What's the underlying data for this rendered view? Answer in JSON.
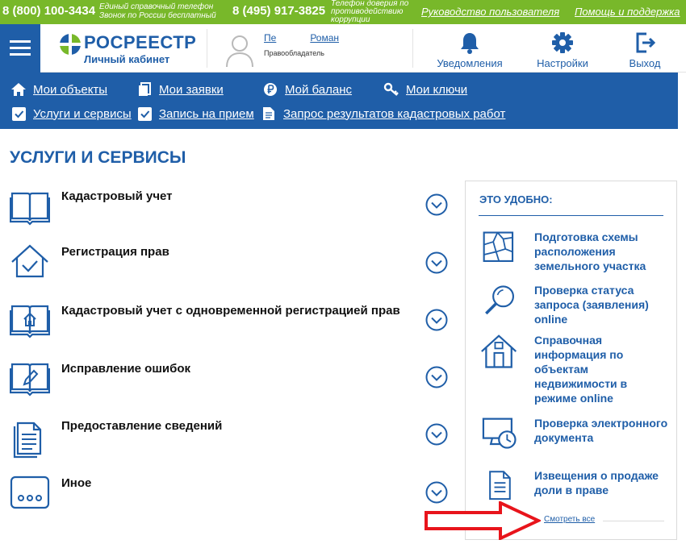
{
  "topbar": {
    "phone1": "8 (800) 100-3434",
    "phone1_note_line1": "Единый справочный телефон",
    "phone1_note_line2": "Звонок по России бесплатный",
    "phone2": "8 (495) 917-3825",
    "phone2_note": "Телефон доверия по противодействию коррупции",
    "link_manual": "Руководство пользователя",
    "link_help": "Помощь и поддержка",
    "color": "#78b82a"
  },
  "header": {
    "logo_title": "РОСРЕЕСТР",
    "logo_subtitle": "Личный кабинет",
    "user_first": "Пе",
    "user_last": "Роман",
    "user_role": "Правообладатель",
    "buttons": {
      "notifications": "Уведомления",
      "settings": "Настройки",
      "logout": "Выход"
    },
    "accent": "#1f5ea8"
  },
  "nav": {
    "row1": [
      {
        "label": "Мои объекты",
        "icon": "home-icon"
      },
      {
        "label": "Мои заявки",
        "icon": "documents-icon"
      },
      {
        "label": "Мой баланс",
        "icon": "ruble-icon"
      },
      {
        "label": "Мои ключи",
        "icon": "key-icon"
      }
    ],
    "row2": [
      {
        "label": "Услуги и сервисы",
        "icon": "checkbox-icon"
      },
      {
        "label": "Запись на прием",
        "icon": "checkbox-icon"
      },
      {
        "label": "Запрос результатов кадастровых работ",
        "icon": "document-icon"
      }
    ]
  },
  "main": {
    "title": "УСЛУГИ И СЕРВИСЫ",
    "services": [
      {
        "title": "Кадастровый учет",
        "icon": "open-book-icon"
      },
      {
        "title": "Регистрация прав",
        "icon": "house-check-icon"
      },
      {
        "title": "Кадастровый учет с одновременной регистрацией прав",
        "icon": "book-house-icon"
      },
      {
        "title": "Исправление ошибок",
        "icon": "book-pencil-icon"
      },
      {
        "title": "Предоставление сведений",
        "icon": "document-stack-icon"
      },
      {
        "title": "Иное",
        "icon": "dots-icon"
      }
    ]
  },
  "panel": {
    "title": "ЭТО УДОБНО:",
    "items": [
      {
        "label": "Подготовка схемы расположения земельного участка",
        "icon": "land-plot-icon"
      },
      {
        "label": "Проверка статуса запроса (заявления) online",
        "icon": "magnifier-icon"
      },
      {
        "label": "Справочная информация по объектам недвижимости в режиме online",
        "icon": "house-icon"
      },
      {
        "label": "Проверка электронного документа",
        "icon": "monitor-clock-icon"
      },
      {
        "label": "Извещения о продаже доли в праве",
        "icon": "document-icon"
      }
    ],
    "see_all": "Смотреть все"
  },
  "annotation": {
    "color": "#e8141b"
  }
}
